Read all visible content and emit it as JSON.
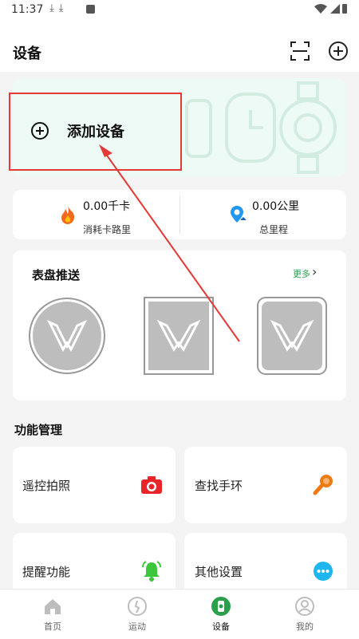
{
  "status_bar": {
    "time": "11:37"
  },
  "header": {
    "title": "设备"
  },
  "add_device": {
    "label": "添加设备"
  },
  "stats": {
    "calories_value": "0.00千卡",
    "calories_label": "消耗卡路里",
    "distance_value": "0.00公里",
    "distance_label": "总里程"
  },
  "dials": {
    "title": "表盘推送",
    "more": "更多"
  },
  "functions": {
    "section_title": "功能管理",
    "items": [
      {
        "label": "遥控拍照"
      },
      {
        "label": "查找手环"
      },
      {
        "label": "提醒功能"
      },
      {
        "label": "其他设置"
      }
    ]
  },
  "tabs": [
    {
      "label": "首页"
    },
    {
      "label": "运动"
    },
    {
      "label": "设备"
    },
    {
      "label": "我的"
    }
  ],
  "colors": {
    "accent": "#2aa04a",
    "annotation": "#e53935",
    "camera": "#e8262a",
    "search": "#f07a12",
    "bell": "#3cc63c",
    "more": "#1fb6f0"
  }
}
